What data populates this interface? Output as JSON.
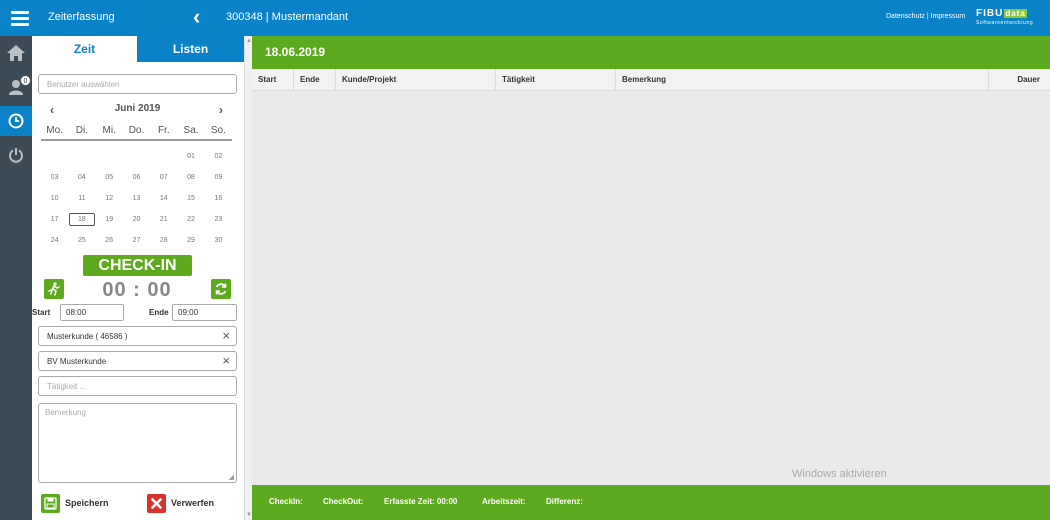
{
  "header": {
    "app_title": "Zeiterfassung",
    "tenant": "300348 | Mustermandant",
    "links": "Datenschutz | Impressum",
    "logo_word1": "FIBU",
    "logo_word2": "data",
    "logo_tagline": "Softwareentwicklung"
  },
  "nav": {
    "badge_count": "0"
  },
  "tabs": {
    "zeit": "Zeit",
    "listen": "Listen"
  },
  "form": {
    "user_placeholder": "Benutzer auswählen",
    "customer": "Musterkunde ( 46586 )",
    "project": "BV Musterkunde",
    "activity_placeholder": "Tätigkeit ...",
    "remark_placeholder": "Bemerkung",
    "start_label": "Start",
    "start_value": "08:00",
    "end_label": "Ende",
    "end_value": "09:00"
  },
  "calendar": {
    "month": "Juni 2019",
    "prev": "‹",
    "next": "›",
    "weekdays": [
      "Mo.",
      "Di.",
      "Mi.",
      "Do.",
      "Fr.",
      "Sa.",
      "So."
    ],
    "weeks": [
      [
        "",
        "",
        "",
        "",
        "",
        "01",
        "02"
      ],
      [
        "03",
        "04",
        "05",
        "06",
        "07",
        "08",
        "09"
      ],
      [
        "10",
        "11",
        "12",
        "13",
        "14",
        "15",
        "16"
      ],
      [
        "17",
        "18",
        "19",
        "20",
        "21",
        "22",
        "23"
      ],
      [
        "24",
        "25",
        "26",
        "27",
        "28",
        "29",
        "30"
      ]
    ],
    "selected": "18"
  },
  "checkin": {
    "label": "CHECK-IN",
    "timer": "00 : 00"
  },
  "actions": {
    "save": "Speichern",
    "discard": "Verwerfen"
  },
  "main": {
    "date": "18.06.2019",
    "columns": [
      "Start",
      "Ende",
      "Kunde/Projekt",
      "Tätigkeit",
      "Bemerkung",
      "Dauer"
    ],
    "watermark": "Windows aktivieren"
  },
  "footer": {
    "checkin": "CheckIn:",
    "checkout": "CheckOut:",
    "recorded": "Erfasste Zeit: 00:00",
    "worktime": "Arbeitszeit:",
    "difference": "Differenz:"
  },
  "colors": {
    "brand_blue": "#0a82c8",
    "brand_green": "#5daa1e",
    "nav_dark": "#3c4a55",
    "danger": "#d9322c"
  }
}
